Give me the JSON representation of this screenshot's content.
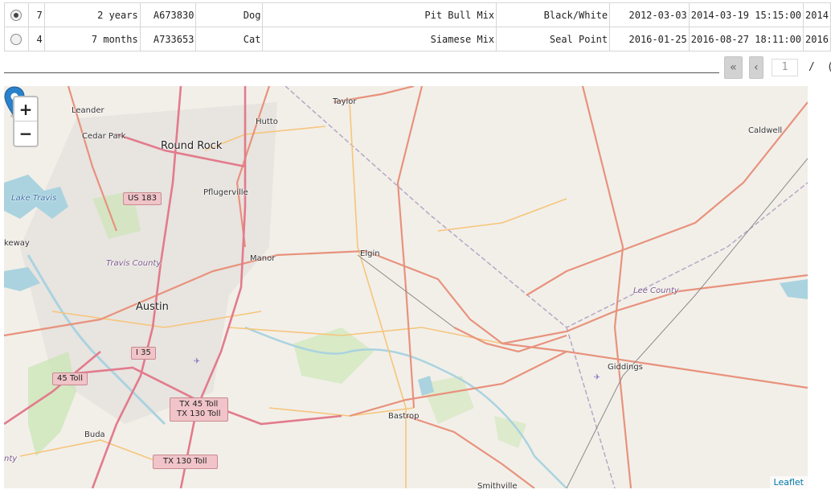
{
  "table": {
    "rows": [
      {
        "selected": true,
        "cells": [
          "7",
          "2 years",
          "A673830",
          "Dog",
          "Pit Bull Mix",
          "Black/White",
          "2012-03-03",
          "2014-03-19 15:15:00",
          "2014"
        ]
      },
      {
        "selected": false,
        "cells": [
          "4",
          "7 months",
          "A733653",
          "Cat",
          "Siamese Mix",
          "Seal Point",
          "2016-01-25",
          "2016-08-27 18:11:00",
          "2016"
        ]
      }
    ]
  },
  "pager": {
    "first_label": "«",
    "prev_label": "‹",
    "page_value": "1",
    "separator": "/",
    "next_partial": "("
  },
  "map": {
    "zoom_in": "+",
    "zoom_out": "−",
    "attribution": "Leaflet",
    "places": {
      "leander": "Leander",
      "cedar_park": "Cedar Park",
      "round_rock": "Round Rock",
      "taylor": "Taylor",
      "hutto": "Hutto",
      "pflugerville": "Pflugerville",
      "lake_travis": "Lake Travis",
      "lakeway": "keway",
      "travis_county": "Travis County",
      "manor": "Manor",
      "elgin": "Elgin",
      "austin": "Austin",
      "caldwell": "Caldwell",
      "lee_county": "Lee County",
      "giddings": "Giddings",
      "bastrop": "Bastrop",
      "buda": "Buda",
      "smithville": "Smithville",
      "county_left": "nty"
    },
    "shields": {
      "us183": "US 183",
      "i35": "I 35",
      "toll45": "45 Toll",
      "tx45_line1": "TX 45 Toll",
      "tx45_line2": "TX 130 Toll",
      "tx130": "TX 130 Toll"
    },
    "colors": {
      "land": "#f2efe9",
      "major_road": "#e8927c",
      "highway": "#e27b8c",
      "minor_road": "#f6c57a",
      "water": "#aad3df",
      "park": "#c8e6b0",
      "marker": "#2a81cb"
    }
  }
}
